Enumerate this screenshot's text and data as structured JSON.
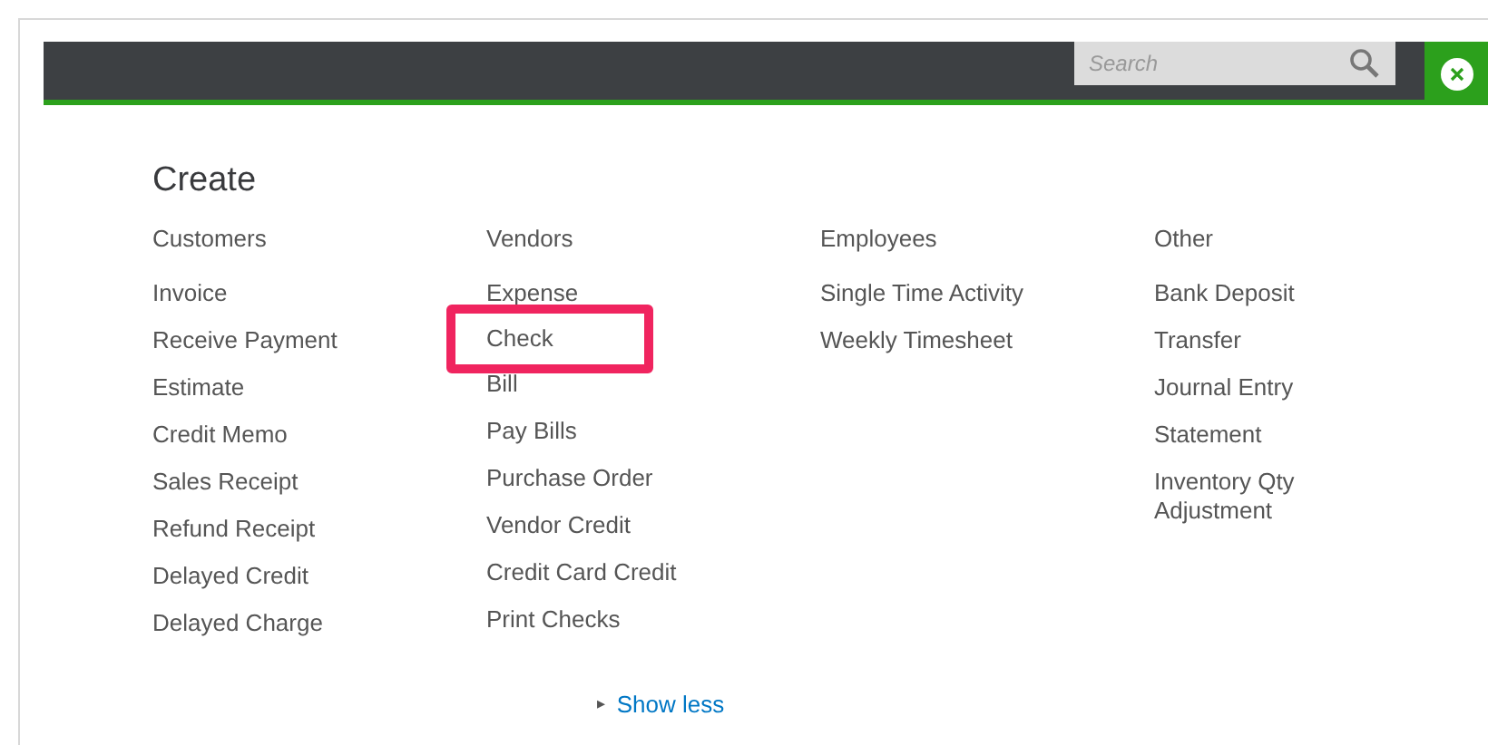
{
  "search": {
    "placeholder": "Search"
  },
  "title": "Create",
  "columns": [
    {
      "heading": "Customers",
      "items": [
        {
          "label": "Invoice",
          "highlighted": false
        },
        {
          "label": "Receive Payment",
          "highlighted": false
        },
        {
          "label": "Estimate",
          "highlighted": false
        },
        {
          "label": "Credit Memo",
          "highlighted": false
        },
        {
          "label": "Sales Receipt",
          "highlighted": false
        },
        {
          "label": "Refund Receipt",
          "highlighted": false
        },
        {
          "label": "Delayed Credit",
          "highlighted": false
        },
        {
          "label": "Delayed Charge",
          "highlighted": false
        }
      ]
    },
    {
      "heading": "Vendors",
      "items": [
        {
          "label": "Expense",
          "highlighted": false
        },
        {
          "label": "Check",
          "highlighted": true
        },
        {
          "label": "Bill",
          "highlighted": false
        },
        {
          "label": "Pay Bills",
          "highlighted": false
        },
        {
          "label": "Purchase Order",
          "highlighted": false
        },
        {
          "label": "Vendor Credit",
          "highlighted": false
        },
        {
          "label": "Credit Card Credit",
          "highlighted": false
        },
        {
          "label": "Print Checks",
          "highlighted": false
        }
      ]
    },
    {
      "heading": "Employees",
      "items": [
        {
          "label": "Single Time Activity",
          "highlighted": false
        },
        {
          "label": "Weekly Timesheet",
          "highlighted": false
        }
      ]
    },
    {
      "heading": "Other",
      "items": [
        {
          "label": "Bank Deposit",
          "highlighted": false
        },
        {
          "label": "Transfer",
          "highlighted": false
        },
        {
          "label": "Journal Entry",
          "highlighted": false
        },
        {
          "label": "Statement",
          "highlighted": false
        },
        {
          "label": "Inventory Qty Adjustment",
          "highlighted": false
        }
      ]
    }
  ],
  "toggle": {
    "arrow": "▸",
    "label": "Show less"
  }
}
